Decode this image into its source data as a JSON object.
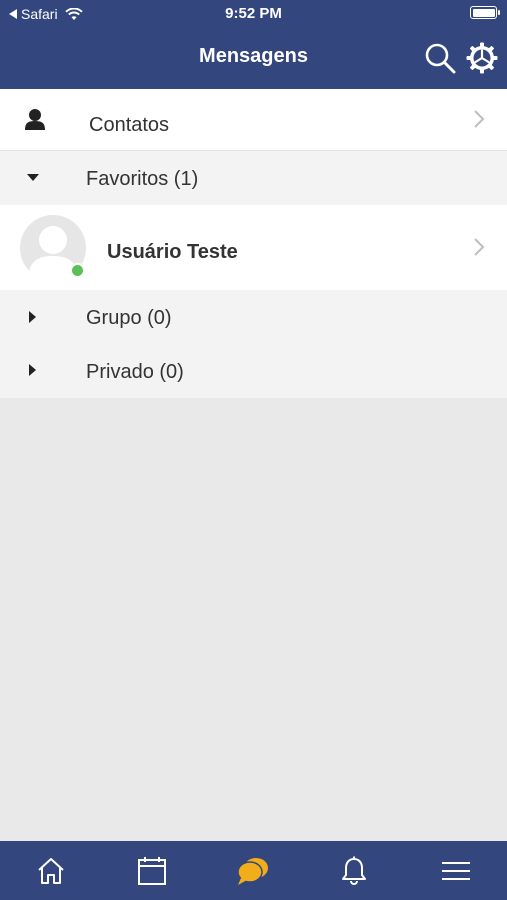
{
  "status_bar": {
    "back_app": "Safari",
    "time": "9:52 PM"
  },
  "header": {
    "title": "Mensagens"
  },
  "list": {
    "contacts": {
      "label": "Contatos"
    },
    "favorites": {
      "label": "Favoritos (1)",
      "expanded": true
    },
    "favorite_contact": {
      "name": "Usuário Teste",
      "online": true
    },
    "group": {
      "label": "Grupo (0)",
      "expanded": false
    },
    "private": {
      "label": "Privado (0)",
      "expanded": false
    }
  },
  "tabbar": {
    "items": [
      "home-icon",
      "calendar-icon",
      "chat-icon",
      "bell-icon",
      "menu-icon"
    ],
    "active": "chat-icon"
  },
  "colors": {
    "primary": "#33467d",
    "accent": "#f2ad1b",
    "online": "#5cbf57"
  }
}
